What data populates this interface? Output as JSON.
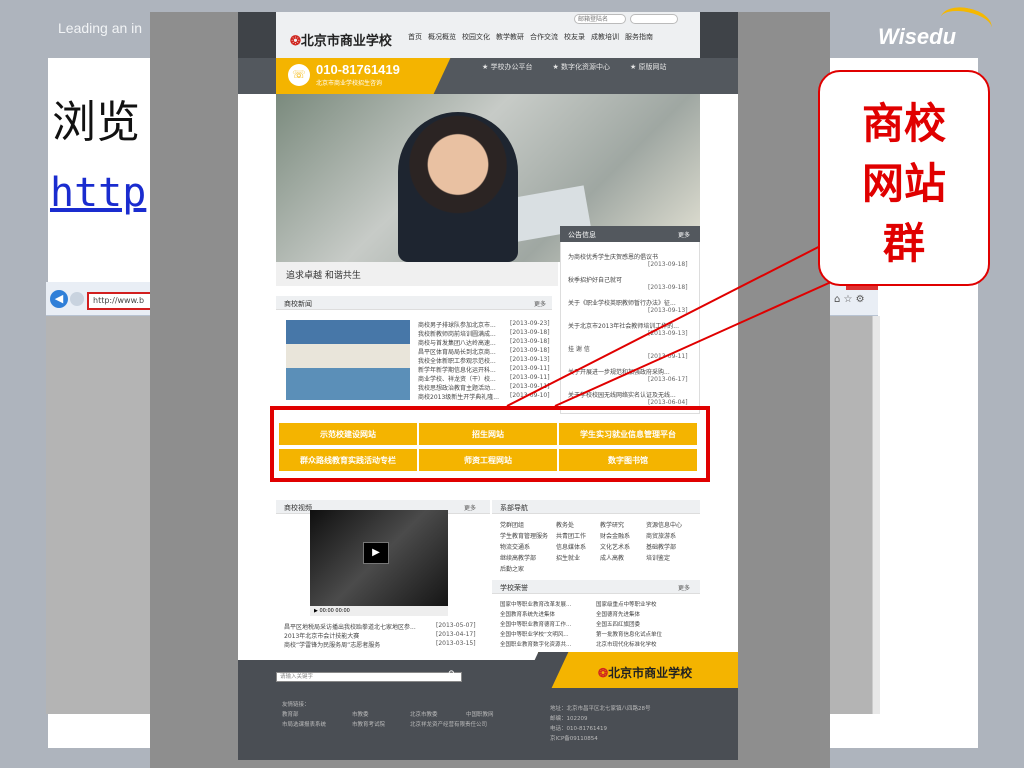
{
  "slide": {
    "tagline": "Leading an in",
    "logo": "Wisedu",
    "title": "浏览",
    "url": "http",
    "callout": "商校网站群"
  },
  "browser": {
    "address": "http://www.b",
    "back_icon": "back-arrow-icon",
    "close": "×"
  },
  "site": {
    "logo_mark": "❂",
    "logo_text": "北京市商业学校",
    "nav": [
      "首页",
      "概况概览",
      "校园文化",
      "教学教研",
      "合作交流",
      "校友录",
      "成教培训",
      "服务指南"
    ],
    "search_top_placeholder": "邮箱登陆名",
    "phone": "010-81761419",
    "phone_sub": "北京市商业学校招生咨询",
    "quick_links": [
      "学校办公平台",
      "数字化资源中心",
      "原版网站"
    ],
    "slogan": "追求卓越  和谐共生",
    "notice": {
      "title": "公告信息",
      "more": "更多",
      "items": [
        {
          "text": "为商校优秀学生庆贺感恩的倡议书",
          "date": "[2013-09-18]"
        },
        {
          "text": "秋季招护好自己就可",
          "date": "[2013-09-18]"
        },
        {
          "text": "关于《职业学校英职教师暂行办法》征...",
          "date": "[2013-09-13]"
        },
        {
          "text": "关于北京市2013年社会教师培训工作的...",
          "date": "[2013-09-13]"
        },
        {
          "text": "挂 谢 信",
          "date": "[2013-09-11]"
        },
        {
          "text": "关于开展进一步规范和加强政府采购...",
          "date": "[2013-06-17]"
        },
        {
          "text": "关于学校校园无线网络实名认证及无线...",
          "date": "[2013-06-04]"
        }
      ]
    },
    "news": {
      "title": "商校新闻",
      "more": "更多",
      "items": [
        {
          "text": "商校男子排球队参加北京市...",
          "date": "[2013-09-23]"
        },
        {
          "text": "我校新教师岗前培训圆满成...",
          "date": "[2013-09-18]"
        },
        {
          "text": "商校与首发集团八达岭高速...",
          "date": "[2013-09-18]"
        },
        {
          "text": "昌平区体育局局长到北京商...",
          "date": "[2013-09-18]"
        },
        {
          "text": "我校全体新职工参观示范校...",
          "date": "[2013-09-13]"
        },
        {
          "text": "新学年新学期信息化运开科...",
          "date": "[2013-09-11]"
        },
        {
          "text": "商业学校、祥龙资（干）校...",
          "date": "[2013-09-11]"
        },
        {
          "text": "我校思想政治教育主题活动...",
          "date": "[2013-09-11]"
        },
        {
          "text": "商校2013级新生开学典礼隆...",
          "date": "[2013-09-10]"
        }
      ]
    },
    "links": [
      "示范校建设网站",
      "招生网站",
      "学生实习就业信息管理平台",
      "群众路线教育实践活动专栏",
      "师资工程网站",
      "数字图书馆"
    ],
    "video": {
      "title": "商校视频",
      "more": "更多",
      "time": "00:00      00:00",
      "items": [
        {
          "text": "昌平区地税局采访播出我校跆拳道北七家地区参...",
          "date": "[2013-05-07]"
        },
        {
          "text": "2013年北京市会计技能大赛",
          "date": "[2013-04-17]"
        },
        {
          "text": "商校“学雷锋为民服务周”志愿者服务",
          "date": "[2013-03-15]"
        }
      ]
    },
    "depts": {
      "title": "系部导航",
      "items": [
        "党群团组",
        "教务处",
        "教学研究",
        "资源信息中心",
        "学生教育管理服务",
        "共青团工作",
        "财会金融系",
        "商贸旅游系",
        "物流交通系",
        "信息媒体系",
        "文化艺术系",
        "基础教学部",
        "继续高教学部",
        "招生就业",
        "成人高教",
        "培训鉴定",
        "后勤之家"
      ]
    },
    "honors": {
      "title": "学校荣誉",
      "more": "更多",
      "items": [
        "国家中等职业教育改革发展...",
        "国家级重点中等职业学校",
        "全国教育系统先进集体",
        "全国德育先进集体",
        "全国中等职业教育德育工作...",
        "全国五四红旗团委",
        "全国中等职业学校“文明风...",
        "第一批教育信息化试点单位",
        "全国职业教育数字化资源共...",
        "北京市现代化标准化学校"
      ]
    },
    "footer": {
      "search_placeholder": "请输入关键字",
      "search_icon": "magnifier-icon",
      "links_title": "友情链接：",
      "links": [
        "教育部",
        "市教委",
        "北京市教委",
        "中国职教网",
        "市局选课报表系统",
        "市教育考试院",
        "北京祥龙资产经营有限责任公司"
      ],
      "address": "地址：北京市昌平区北七家镇八四路28号",
      "zip": "邮编：102209",
      "tel": "电话：010-81761419",
      "icp": "京ICP备09110854"
    }
  }
}
